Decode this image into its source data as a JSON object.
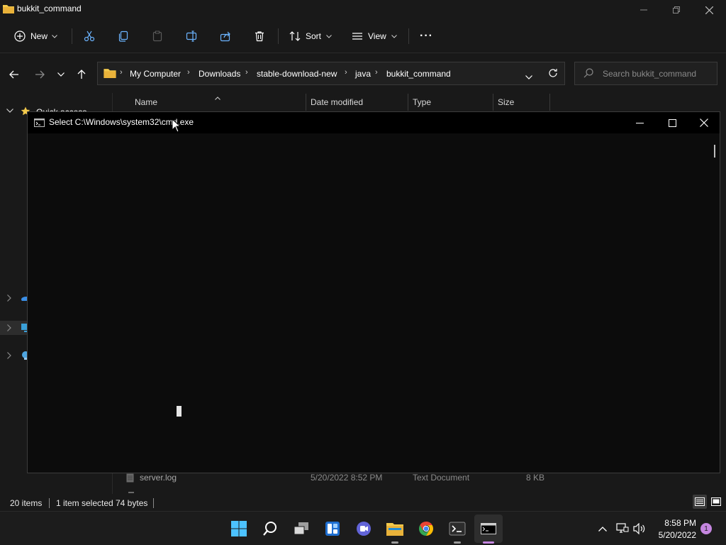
{
  "explorer": {
    "window_title": "bukkit_command",
    "toolbar": {
      "new_label": "New",
      "sort_label": "Sort",
      "view_label": "View",
      "more_label": "···"
    },
    "breadcrumb": [
      "My Computer",
      "Downloads",
      "stable-download-new",
      "java",
      "bukkit_command"
    ],
    "search_placeholder": "Search bukkit_command",
    "columns": [
      "Name",
      "Date modified",
      "Type",
      "Size"
    ],
    "nav_pane": {
      "quick_access_label": "Quick access"
    },
    "visible_file": {
      "name": "server.log",
      "date_modified": "5/20/2022 8:52 PM",
      "type": "Text Document",
      "size": "8 KB"
    },
    "status": {
      "item_count": "20 items",
      "selection": "1 item selected",
      "selection_size": "74 bytes"
    }
  },
  "cmd": {
    "title": "Select C:\\Windows\\system32\\cmd.exe",
    "title_icon": "C:\\_"
  },
  "taskbar": {
    "apps": [
      "start-icon",
      "search-icon",
      "task-view-icon",
      "widgets-icon",
      "chat-icon",
      "file-explorer-icon",
      "chrome-icon",
      "terminal-icon",
      "cmd-icon"
    ],
    "time": "8:58 PM",
    "date": "5/20/2022",
    "notification_count": "1"
  },
  "colors": {
    "explorer_bg": "#191919",
    "cmd_bg": "#0c0c0c",
    "folder_yellow": "#f2c94c",
    "accent": "#c586e0"
  }
}
